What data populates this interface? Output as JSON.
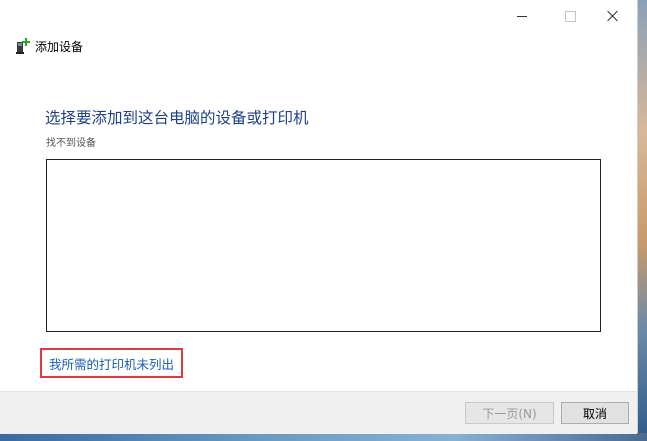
{
  "window": {
    "title": "添加设备",
    "app_icon": "add-device-icon"
  },
  "titlebar": {
    "minimize_icon": "minimize-icon",
    "maximize_icon": "maximize-icon",
    "close_icon": "close-icon"
  },
  "main": {
    "heading": "选择要添加到这台电脑的设备或打印机",
    "status": "找不到设备",
    "printer_link": "我所需的打印机未列出"
  },
  "footer": {
    "next_label": "下一页(N)",
    "cancel_label": "取消"
  },
  "colors": {
    "heading": "#1e3f8a",
    "link": "#1a5fb4",
    "highlight_border": "#e0393e"
  }
}
